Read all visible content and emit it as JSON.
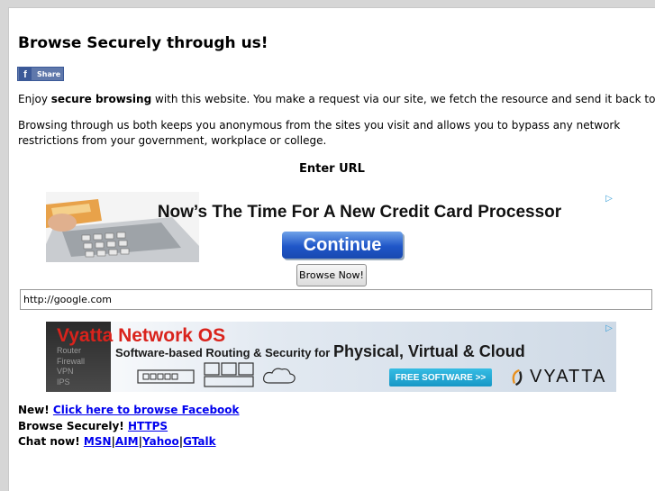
{
  "page": {
    "title": "Browse Securely through us!",
    "share_label": "Share",
    "share_icon": "facebook-icon",
    "intro_before": "Enjoy ",
    "intro_bold": "secure browsing",
    "intro_after": " with this website. You make a request via our site, we fetch the resource and send it back to you.",
    "paragraph2": "Browsing through us both keeps you anonymous from the sites you visit and allows you to bypass any network restrictions from your government, workplace or college.",
    "enter_url_label": "Enter URL",
    "browse_button": "Browse Now!",
    "url_value": "http://google.com"
  },
  "ad_top": {
    "headline": "Now’s The Time For A New Credit Card Processor",
    "button": "Continue",
    "adchoices_icon": "adchoices-icon"
  },
  "ad_bottom": {
    "title": "Vyatta Network OS",
    "features": [
      "Router",
      "Firewall",
      "VPN",
      "IPS"
    ],
    "subtitle_small": "Software-based Routing & Security for ",
    "subtitle_big": "Physical, Virtual & Cloud",
    "cta": "FREE SOFTWARE >>",
    "brand": "VYATTA",
    "adchoices_icon": "adchoices-icon"
  },
  "footer": {
    "line1_prefix": "New! ",
    "line1_link": "Click here to browse Facebook",
    "line2_prefix": "Browse Securely! ",
    "line2_link": "HTTPS",
    "line3_prefix": "Chat now! ",
    "chat_links": [
      "MSN",
      "AIM",
      "Yahoo",
      "GTalk"
    ],
    "separator": "|"
  },
  "colors": {
    "link": "#0000ee",
    "facebook": "#3b5998",
    "vyatta_red": "#d9231c",
    "continue_blue": "#1f56c8",
    "cta_cyan": "#1797c6"
  }
}
